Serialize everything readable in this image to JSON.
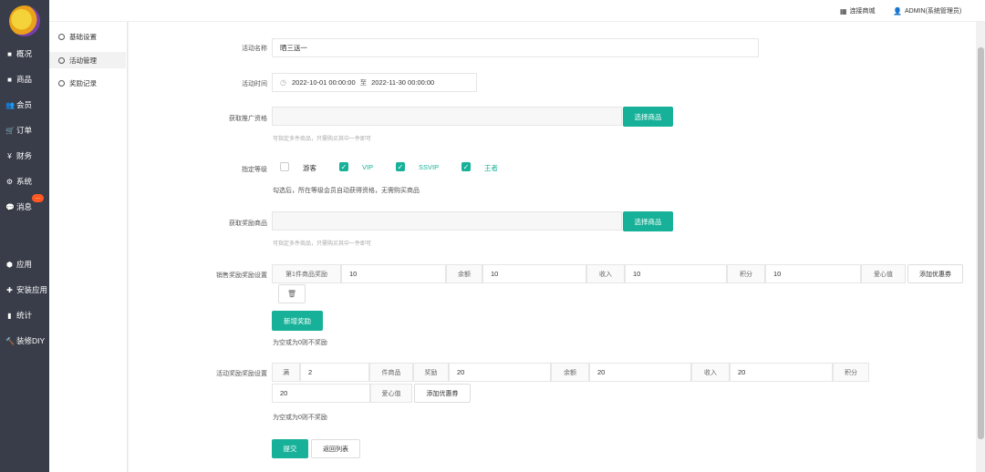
{
  "colors": {
    "accent": "#16b198",
    "sidebar_bg": "#393d49",
    "badge": "#ff5722"
  },
  "nav": {
    "badge": "...",
    "items": [
      {
        "icon": "square-icon",
        "glyph": "■",
        "label": "概况"
      },
      {
        "icon": "square-icon",
        "glyph": "■",
        "label": "商品"
      },
      {
        "icon": "users-icon",
        "glyph": "👥",
        "label": "会员"
      },
      {
        "icon": "cart-icon",
        "glyph": "🛒",
        "label": "订单"
      },
      {
        "icon": "yen-icon",
        "glyph": "¥",
        "label": "财务"
      },
      {
        "icon": "gears-icon",
        "glyph": "⚙",
        "label": "系统"
      },
      {
        "icon": "message-icon",
        "glyph": "💬",
        "label": "消息"
      },
      {
        "icon": "cubes-icon",
        "glyph": "⬢",
        "label": "应用"
      },
      {
        "icon": "puzzle-icon",
        "glyph": "✚",
        "label": "安装应用"
      },
      {
        "icon": "bar-chart-icon",
        "glyph": "▮",
        "label": "统计"
      },
      {
        "icon": "hammer-icon",
        "glyph": "🔨",
        "label": "装修DIY"
      }
    ]
  },
  "subnav": {
    "items": [
      "基础设置",
      "活动管理",
      "奖励记录"
    ]
  },
  "topbar": {
    "store": "连接商城",
    "user": "ADMIN(系统管理员)"
  },
  "form": {
    "name": {
      "label": "活动名称",
      "value": "晒三送一"
    },
    "time": {
      "label": "活动时间",
      "start": "2022-10-01 00:00:00",
      "sep": "至",
      "end": "2022-11-30 00:00:00"
    },
    "qualify_goods": {
      "label": "获取推广资格",
      "button": "选择商品",
      "hint": "可指定多件商品，只需购买其中一件即可"
    },
    "level": {
      "label": "指定等级",
      "options": [
        {
          "label": "游客",
          "checked": false
        },
        {
          "label": "VIP",
          "checked": true
        },
        {
          "label": "SSVIP",
          "checked": true
        },
        {
          "label": "王者",
          "checked": true
        }
      ],
      "note": "勾选后，所在等级会员自动获得资格，无需购买商品"
    },
    "reward_goods": {
      "label": "获取奖励商品",
      "button": "选择商品",
      "hint": "可指定多件商品，只需购买其中一件即可"
    },
    "sales_reward": {
      "label": "销售奖励奖励设置",
      "row": [
        {
          "addon": "第1件商品奖励",
          "value": "10"
        },
        {
          "addon": "余额",
          "value": "10"
        },
        {
          "addon": "收入",
          "value": "10"
        },
        {
          "addon": "积分",
          "value": "10"
        },
        {
          "addon": "爱心值"
        }
      ],
      "coupon": "添加优惠券",
      "add": "新增奖励",
      "note": "为空或为0则不奖励"
    },
    "activity_reward": {
      "label": "活动奖励奖励设置",
      "full": "满",
      "count": "2",
      "unit": "件商品",
      "reward": "奖励",
      "balance_value": "20",
      "balance": "余额",
      "income_value": "20",
      "income": "收入",
      "points_value": "20",
      "points": "积分",
      "love_value": "20",
      "love": "爱心值",
      "coupon": "添加优惠券",
      "note": "为空或为0则不奖励"
    },
    "submit": "提交",
    "back": "返回列表"
  }
}
